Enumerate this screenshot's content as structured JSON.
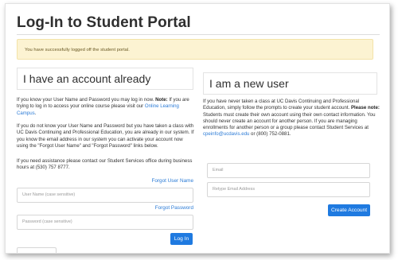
{
  "page": {
    "title": "Log-In to Student Portal"
  },
  "alert": {
    "message": "You have successfully logged off the student portal."
  },
  "login": {
    "heading": "I have an account already",
    "p1_a": "If you know your User Name and Password you may log in now. ",
    "p1_note": "Note:",
    "p1_b": " If you are trying to log in to access your online course please visit our ",
    "p1_link": "Online Learning Campus",
    "p1_end": ".",
    "p2": "If you do not know your User Name and Password but you have taken a class with UC Davis Continuing and Professional Education, you are already in our system. If you know the email address in our system you can activate your account now using the \"Forgot User Name\" and \"Forgot Password\" links below.",
    "p3": "If you need assistance please contact our Student Services office during business hours at (530) 757 8777.",
    "forgot_username": "Forgot User Name",
    "username_placeholder": "User Name (case sensitive)",
    "forgot_password": "Forgot Password",
    "password_placeholder": "Password (case sensitive)",
    "login_button": "Log In"
  },
  "register": {
    "heading": "I am a new user",
    "p1_a": "If you have never taken a class at UC Davis Continuing and Professional Education, simply follow the prompts to create your student account. ",
    "p1_note": "Please note:",
    "p1_b": " Students must create their own account using their own contact information. You should never create an account for another person.  If you are managing enrollments for another person or a group please contact Student Services at ",
    "p1_email": "cpeinfo@ucdavis.edu",
    "p1_end": " or (800) 752-0881.",
    "email_placeholder": "Email",
    "retype_placeholder": "Retype Email Address",
    "create_button": "Create Account"
  },
  "colors": {
    "accent": "#1f7ae0",
    "link": "#2b7bd6",
    "alert_bg": "#fcf3d2"
  }
}
